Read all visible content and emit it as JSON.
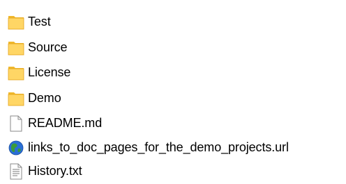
{
  "explorer": {
    "items": [
      {
        "name": "Test",
        "icon": "folder-icon"
      },
      {
        "name": "Source",
        "icon": "folder-icon"
      },
      {
        "name": "License",
        "icon": "folder-icon"
      },
      {
        "name": "Demo",
        "icon": "folder-icon"
      },
      {
        "name": "README.md",
        "icon": "blank-document-icon"
      },
      {
        "name": "links_to_doc_pages_for_the_demo_projects.url",
        "icon": "internet-shortcut-globe-icon"
      },
      {
        "name": "History.txt",
        "icon": "text-document-icon"
      }
    ]
  },
  "colors": {
    "folder_body": "#ffd665",
    "folder_back": "#f0b82c",
    "folder_edge": "#e3a21a",
    "doc_border": "#8a8a8a",
    "doc_fill": "#ffffff",
    "text": "#000000",
    "globe_blue": "#2a6fd6",
    "globe_green": "#3a9b3a"
  }
}
